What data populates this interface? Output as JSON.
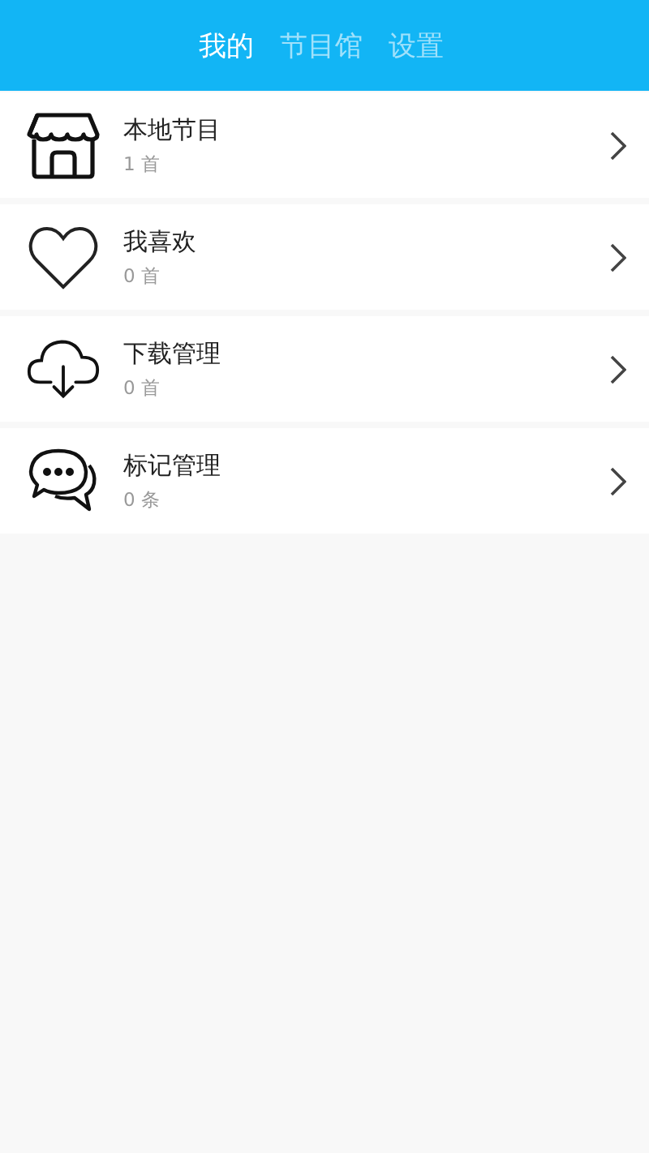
{
  "tabs": [
    {
      "label": "我的",
      "selected": true
    },
    {
      "label": "节目馆",
      "selected": false
    },
    {
      "label": "设置",
      "selected": false
    }
  ],
  "items": [
    {
      "kind": "store",
      "title": "本地节目",
      "count": "1 首"
    },
    {
      "kind": "heart",
      "title": "我喜欢",
      "count": "0 首"
    },
    {
      "kind": "download",
      "title": "下载管理",
      "count": "0 首"
    },
    {
      "kind": "chat",
      "title": "标记管理",
      "count": "0 条"
    }
  ]
}
